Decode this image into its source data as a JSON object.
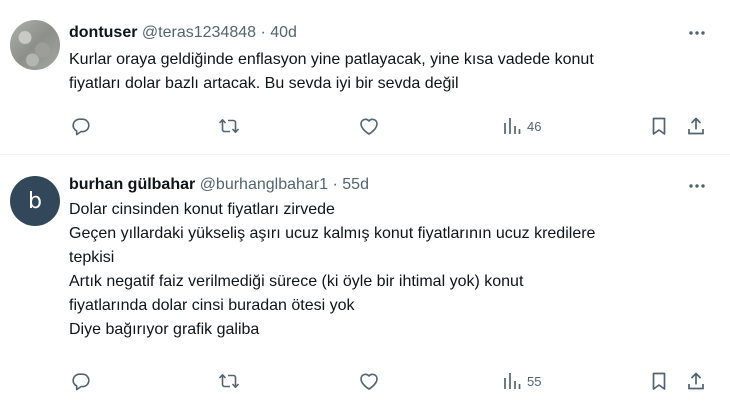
{
  "tweets": [
    {
      "display_name": "dontuser",
      "handle": "@teras1234848",
      "separator": "·",
      "time": "40d",
      "avatar": {
        "type": "photo",
        "icon": "gravel-photo"
      },
      "lines": [
        "Kurlar oraya geldiğinde enflasyon yine patlayacak, yine kısa vadede konut",
        "fiyatları dolar bazlı artacak. Bu sevda iyi bir sevda değil"
      ],
      "views": "46"
    },
    {
      "display_name": "burhan gülbahar",
      "handle": "@burhanglbahar1",
      "separator": "·",
      "time": "55d",
      "avatar": {
        "type": "letter",
        "letter": "b",
        "color": "#33475b"
      },
      "lines": [
        "Dolar cinsinden konut fiyatları zirvede",
        "Geçen yıllardaki yükseliş aşırı ucuz kalmış konut fiyatlarının ucuz kredilere",
        "tepkisi",
        "Artık negatif faiz verilmediği sürece (ki öyle bir ihtimal yok) konut",
        "fiyatlarında dolar cinsi buradan ötesi yok",
        "Diye bağırıyor grafik galiba"
      ],
      "views": "55"
    }
  ],
  "icons": {
    "more": "more-dots-icon",
    "reply": "reply-icon",
    "retweet": "retweet-icon",
    "like": "heart-icon",
    "views": "views-bar-chart-icon",
    "bookmark": "bookmark-icon",
    "share": "share-icon"
  },
  "colors": {
    "text": "#0f1419",
    "secondary": "#536471",
    "divider": "#eff3f4",
    "avatar_b": "#33475b"
  }
}
